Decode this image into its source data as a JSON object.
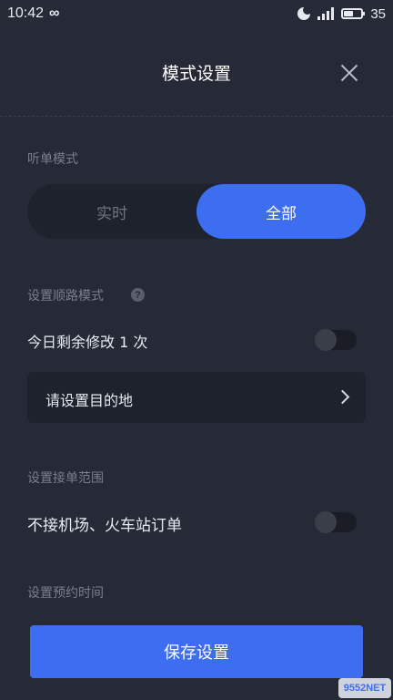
{
  "status_bar": {
    "time": "10:42",
    "loop_icon": "∞",
    "icons": [
      "moon-icon",
      "signal-icon",
      "battery-icon"
    ],
    "battery": "35"
  },
  "header": {
    "title": "模式设置",
    "close_icon": "close-icon"
  },
  "listen_mode": {
    "label": "听单模式",
    "options": [
      "实时",
      "全部"
    ],
    "selected": "全部"
  },
  "route_mode": {
    "label": "设置顺路模式",
    "help_icon": "?",
    "remaining_text": "今日剩余修改 1 次",
    "switch_on": false,
    "destination_label": "请设置目的地"
  },
  "order_range": {
    "label": "设置接单范围",
    "option_text": "不接机场、火车站订单",
    "switch_on": false
  },
  "reservation": {
    "label": "设置预约时间"
  },
  "save_button": {
    "label": "保存设置"
  },
  "watermark": {
    "text": "9552NET"
  },
  "colors": {
    "background": "#262a36",
    "accent": "#3d6ef2",
    "card": "#1e222c",
    "label_gray": "#7a7f8d"
  }
}
